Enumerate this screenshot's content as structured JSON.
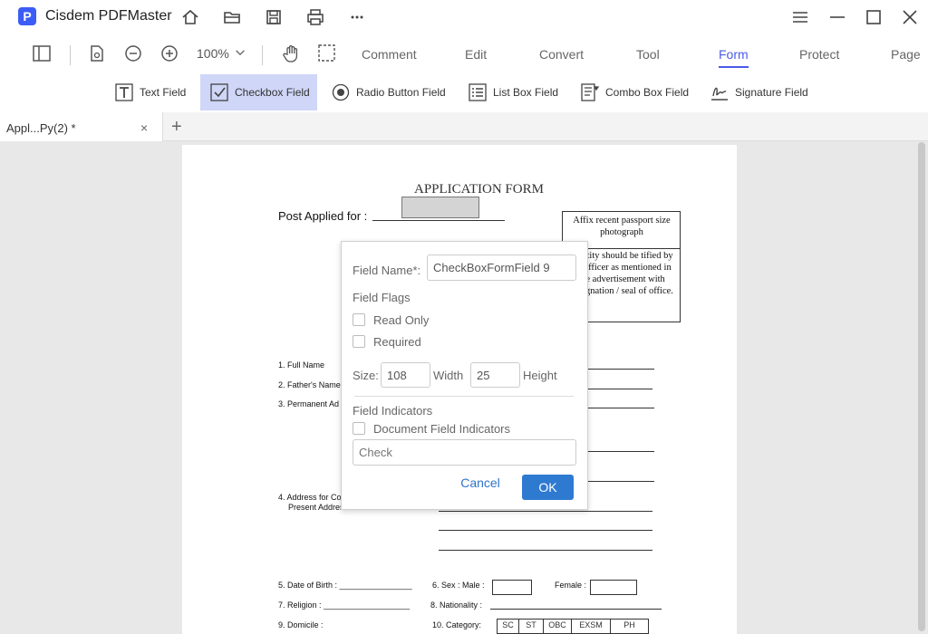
{
  "app": {
    "logo_letter": "P",
    "name": "Cisdem PDFMaster"
  },
  "toolbar": {
    "zoom": "100%"
  },
  "menu_tabs": [
    "Comment",
    "Edit",
    "Convert",
    "Tool",
    "Form",
    "Protect",
    "Page"
  ],
  "active_menu_tab": "Form",
  "form_tools": [
    {
      "label": "Text Field",
      "icon": "text-field-icon"
    },
    {
      "label": "Checkbox Field",
      "icon": "checkbox-field-icon"
    },
    {
      "label": "Radio Button Field",
      "icon": "radio-button-icon"
    },
    {
      "label": "List Box Field",
      "icon": "list-box-icon"
    },
    {
      "label": "Combo Box Field",
      "icon": "combo-box-icon"
    },
    {
      "label": "Signature Field",
      "icon": "signature-icon"
    }
  ],
  "active_form_tool": "Checkbox Field",
  "document_tab": {
    "label": "Appl...Py(2) *",
    "close": "×",
    "add": "+"
  },
  "pdf": {
    "title": "APPLICATION FORM",
    "post_applied": "Post Applied for  :",
    "photo_box_top": "Affix recent passport size photograph",
    "photo_box_bottom": "identity should be tified by an officer as mentioned in the advertisement with designation / seal of office.",
    "full_name": "1. Full Name",
    "fathers_name": "2. Father's Name",
    "permanent_address": "3. Permanent Ad",
    "address_for": "4. Address for Co",
    "present_address": "Present Address",
    "dob": "5. Date of Birth : ________________",
    "sex_male": "6.  Sex : Male :",
    "female": "Female :",
    "religion": "7. Religion : ___________________",
    "nationality": "8.    Nationality :",
    "domicile": "9. Domicile :",
    "category": "10.   Category:",
    "categories": [
      "SC",
      "ST",
      "OBC",
      "EXSM",
      "PH"
    ]
  },
  "dialog": {
    "field_name_label": "Field Name*:",
    "field_name_value": "CheckBoxFormField 9",
    "field_flags_label": "Field Flags",
    "read_only_label": "Read Only",
    "required_label": "Required",
    "size_label": "Size:",
    "width_value": "108",
    "width_label": "Width",
    "height_value": "25",
    "height_label": "Height",
    "field_indicators_label": "Field Indicators",
    "document_field_indicators_label": "Document Field Indicators",
    "check_placeholder": "Check",
    "cancel_label": "Cancel",
    "ok_label": "OK"
  },
  "colors": {
    "accent": "#4a5be8",
    "active_tool_bg": "#cfd6f7",
    "ok_button": "#2f7ad1",
    "logo": "#3b5cf5"
  }
}
